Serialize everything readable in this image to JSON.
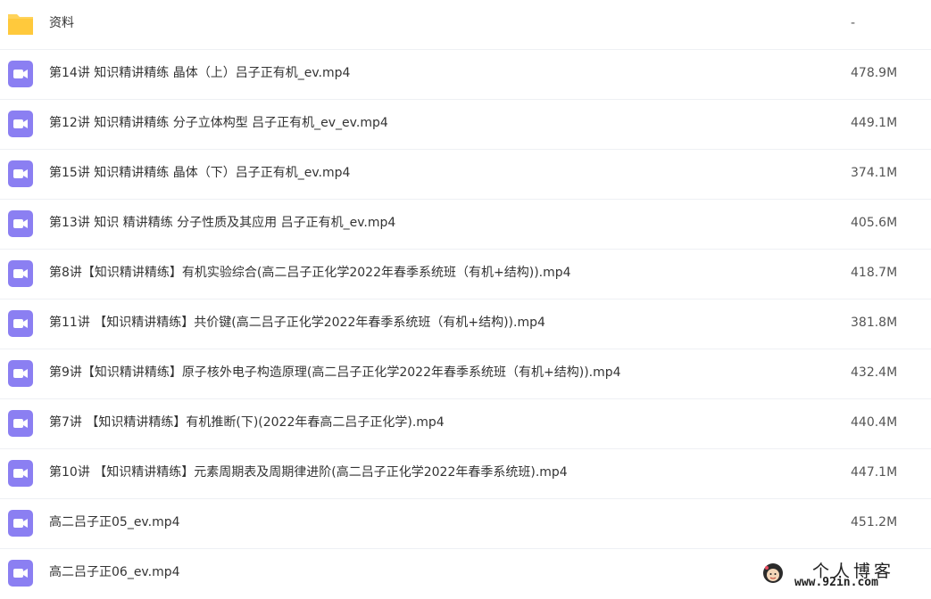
{
  "colors": {
    "folder": "#ffd35a",
    "video": "#8b7ff2",
    "divider": "#eef0f4"
  },
  "files": [
    {
      "type": "folder",
      "icon": "folder-icon",
      "name": "资料",
      "size": "-"
    },
    {
      "type": "video",
      "icon": "video-file-icon",
      "name": "第14讲 知识精讲精练 晶体（上）吕子正有机_ev.mp4",
      "size": "478.9M"
    },
    {
      "type": "video",
      "icon": "video-file-icon",
      "name": "第12讲 知识精讲精练 分子立体构型 吕子正有机_ev_ev.mp4",
      "size": "449.1M"
    },
    {
      "type": "video",
      "icon": "video-file-icon",
      "name": "第15讲 知识精讲精练 晶体（下）吕子正有机_ev.mp4",
      "size": "374.1M"
    },
    {
      "type": "video",
      "icon": "video-file-icon",
      "name": "第13讲 知识 精讲精练 分子性质及其应用 吕子正有机_ev.mp4",
      "size": "405.6M"
    },
    {
      "type": "video",
      "icon": "video-file-icon",
      "name": "第8讲【知识精讲精练】有机实验综合(高二吕子正化学2022年春季系统班（有机+结构)).mp4",
      "size": "418.7M"
    },
    {
      "type": "video",
      "icon": "video-file-icon",
      "name": "第11讲 【知识精讲精练】共价键(高二吕子正化学2022年春季系统班（有机+结构)).mp4",
      "size": "381.8M"
    },
    {
      "type": "video",
      "icon": "video-file-icon",
      "name": "第9讲【知识精讲精练】原子核外电子构造原理(高二吕子正化学2022年春季系统班（有机+结构)).mp4",
      "size": "432.4M"
    },
    {
      "type": "video",
      "icon": "video-file-icon",
      "name": "第7讲 【知识精讲精练】有机推断(下)(2022年春高二吕子正化学).mp4",
      "size": "440.4M"
    },
    {
      "type": "video",
      "icon": "video-file-icon",
      "name": "第10讲 【知识精讲精练】元素周期表及周期律进阶(高二吕子正化学2022年春季系统班).mp4",
      "size": "447.1M"
    },
    {
      "type": "video",
      "icon": "video-file-icon",
      "name": "高二吕子正05_ev.mp4",
      "size": "451.2M"
    },
    {
      "type": "video",
      "icon": "video-file-icon",
      "name": "高二吕子正06_ev.mp4",
      "size": ""
    }
  ],
  "watermark": {
    "title": "个人博客",
    "url": "www.92in.com",
    "icon": "avatar-icon"
  }
}
